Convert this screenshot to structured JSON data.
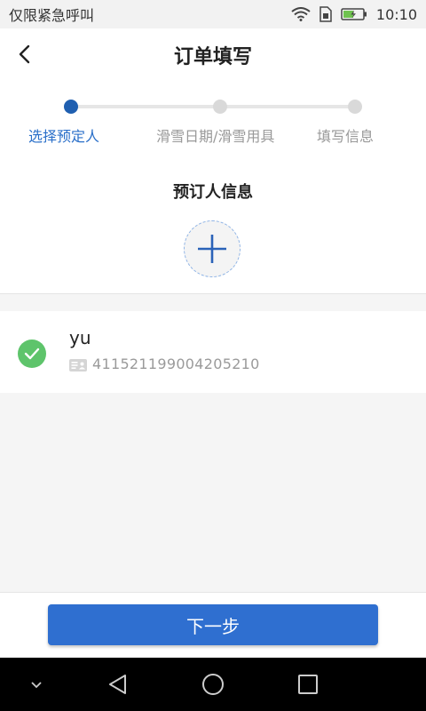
{
  "status_bar": {
    "left_text": "仅限紧急呼叫",
    "time": "10:10",
    "icons": [
      "wifi-icon",
      "sim-icon",
      "battery-charging-icon"
    ]
  },
  "header": {
    "title": "订单填写",
    "back_icon": "back-arrow-icon"
  },
  "progress": {
    "steps": [
      {
        "label": "选择预定人",
        "active": true
      },
      {
        "label": "滑雪日期/滑雪用具",
        "active": false
      },
      {
        "label": "填写信息",
        "active": false
      }
    ],
    "active_color": "#1f5fb0",
    "inactive_color": "#d9d9d9"
  },
  "booker_section": {
    "title": "预订人信息",
    "add_icon": "plus-icon"
  },
  "bookers": [
    {
      "name": "yu",
      "id_number": "411521199004205210",
      "selected": true
    }
  ],
  "footer": {
    "next_label": "下一步",
    "button_color": "#2f6fd0"
  },
  "nav_bar": {
    "icons": [
      "collapse-icon",
      "back-triangle-icon",
      "home-circle-icon",
      "recents-square-icon"
    ]
  }
}
